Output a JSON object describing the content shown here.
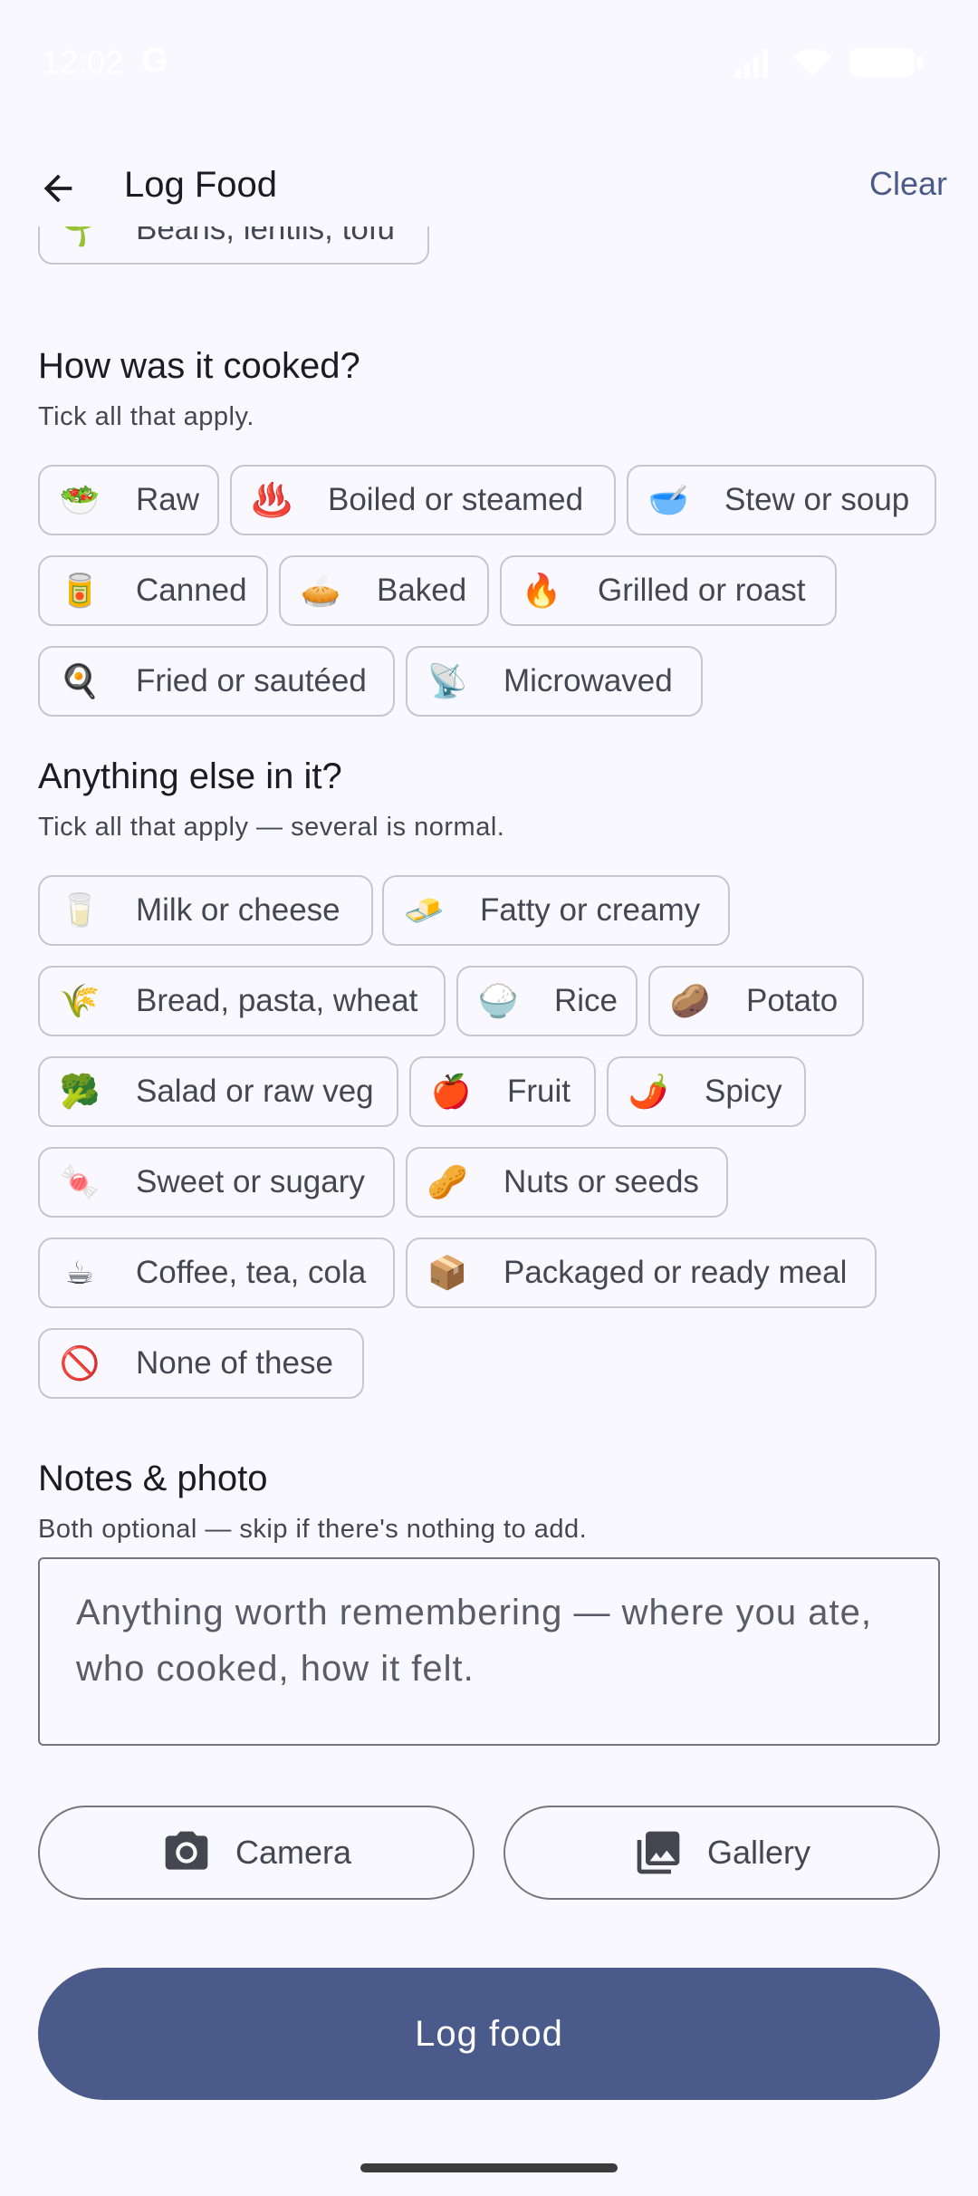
{
  "status": {
    "time": "12:02",
    "g": "G"
  },
  "app_bar": {
    "title": "Log Food",
    "clear_label": "Clear"
  },
  "partial_chip": {
    "emoji": "🌱",
    "label": "Beans, lentils, tofu"
  },
  "cooking": {
    "title": "How was it cooked?",
    "subtitle": "Tick all that apply.",
    "options": [
      {
        "emoji": "🥗",
        "label": "Raw"
      },
      {
        "emoji": "♨️",
        "label": "Boiled or steamed"
      },
      {
        "emoji": "🥣",
        "label": "Stew or soup"
      },
      {
        "emoji": "🥫",
        "label": "Canned"
      },
      {
        "emoji": "🥧",
        "label": "Baked"
      },
      {
        "emoji": "🔥",
        "label": "Grilled or roast"
      },
      {
        "emoji": "🍳",
        "label": "Fried or sautéed"
      },
      {
        "emoji": "📡",
        "label": "Microwaved"
      }
    ]
  },
  "extras": {
    "title": "Anything else in it?",
    "subtitle": "Tick all that apply — several is normal.",
    "options": [
      {
        "emoji": "🥛",
        "label": "Milk or cheese"
      },
      {
        "emoji": "🧈",
        "label": "Fatty or creamy"
      },
      {
        "emoji": "🌾",
        "label": "Bread, pasta, wheat"
      },
      {
        "emoji": "🍚",
        "label": "Rice"
      },
      {
        "emoji": "🥔",
        "label": "Potato"
      },
      {
        "emoji": "🥦",
        "label": "Salad or raw veg"
      },
      {
        "emoji": "🍎",
        "label": "Fruit"
      },
      {
        "emoji": "🌶️",
        "label": "Spicy"
      },
      {
        "emoji": "🍬",
        "label": "Sweet or sugary"
      },
      {
        "emoji": "🥜",
        "label": "Nuts or seeds"
      },
      {
        "emoji": "☕",
        "label": "Coffee, tea, cola"
      },
      {
        "emoji": "📦",
        "label": "Packaged or ready meal"
      },
      {
        "emoji": "🚫",
        "label": "None of these"
      }
    ]
  },
  "notes": {
    "title": "Notes & photo",
    "subtitle": "Both optional — skip if there's nothing to add.",
    "placeholder": "Anything worth remembering — where you ate, who cooked, how it felt."
  },
  "buttons": {
    "camera": "Camera",
    "gallery": "Gallery",
    "submit": "Log food"
  },
  "icons": {
    "back": "arrow-back-icon",
    "camera": "camera-icon",
    "gallery": "gallery-icon"
  },
  "colors": {
    "accent": "#4a5a8a",
    "background": "#f9f8fe",
    "chip_border": "#c6c5d0"
  }
}
